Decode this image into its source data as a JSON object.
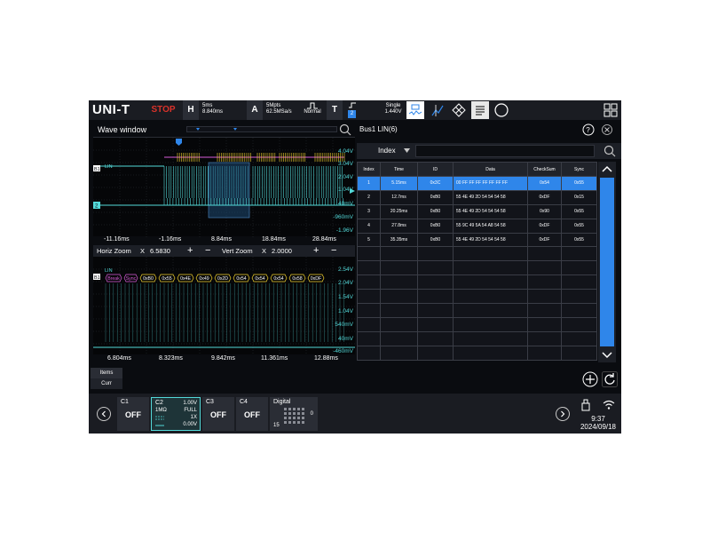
{
  "topbar": {
    "logo": "UNI-T",
    "run_state": "STOP",
    "horizontal": {
      "letter": "H",
      "line1": "5ms",
      "line2": "8.840ms"
    },
    "acquire": {
      "letter": "A",
      "line1": "5Mpts",
      "line2": "62.5MSa/s",
      "mode": "Normal"
    },
    "trigger": {
      "letter": "T",
      "source": "2",
      "mode": "Single",
      "level": "1.440V"
    },
    "colors": {
      "stop": "#d9322a",
      "accent": "#2f86ea",
      "c1": "#f2d22e",
      "c2": "#53d9d9"
    }
  },
  "wave": {
    "title": "Wave window",
    "upper_axis": [
      "-11.16ms",
      "-1.16ms",
      "8.84ms",
      "18.84ms",
      "28.84ms"
    ],
    "upper_volts": [
      "4.04V",
      "3.04V",
      "2.04V",
      "1.04V",
      "40mV",
      "-960mV",
      "-1.96V"
    ],
    "channel_labels": {
      "bus": "B1",
      "lin": "LIN",
      "ch2": "2"
    },
    "zoom": {
      "horiz_label": "Horiz Zoom",
      "horiz_axis": "X",
      "horiz_value": "6.5830",
      "vert_label": "Vert Zoom",
      "vert_axis": "X",
      "vert_value": "2.0000",
      "plus": "+",
      "minus": "−"
    },
    "lower_volts": [
      "2.54V",
      "2.04V",
      "1.54V",
      "1.04V",
      "540mV",
      "40mV",
      "-460mV"
    ],
    "lower_axis": [
      "6.804ms",
      "8.323ms",
      "9.842ms",
      "11.361ms",
      "12.88ms"
    ],
    "decode": [
      "Break",
      "Sync",
      "0xB0",
      "0x55",
      "0x4E",
      "0x49",
      "0x2D",
      "0x54",
      "0x54",
      "0x54",
      "0x58",
      "0xDF"
    ]
  },
  "bus": {
    "title": "Bus1 LIN(6)",
    "index_select": "Index",
    "columns": [
      "Index",
      "Time",
      "ID",
      "Data",
      "CheckSum",
      "Sync"
    ],
    "rows": [
      {
        "index": "1",
        "time": "5.15ms",
        "id": "0x3C",
        "data": "00 FF FF FF FF FF FF FF",
        "checksum": "0x54",
        "sync": "0x55"
      },
      {
        "index": "2",
        "time": "12.7ms",
        "id": "0xB0",
        "data": "55 4E 49 2D 54 54 54 58",
        "checksum": "0xDF",
        "sync": "0x15"
      },
      {
        "index": "3",
        "time": "20.25ms",
        "id": "0xB0",
        "data": "55 4E 49 2D 54 54 54 58",
        "checksum": "0x90",
        "sync": "0x55"
      },
      {
        "index": "4",
        "time": "27.8ms",
        "id": "0xB0",
        "data": "55 9C 49 5A 54 A8 54 58",
        "checksum": "0xDF",
        "sync": "0x55"
      },
      {
        "index": "5",
        "time": "35.35ms",
        "id": "0xB0",
        "data": "55 4E 49 2D 54 54 54 58",
        "checksum": "0xDF",
        "sync": "0x55"
      }
    ]
  },
  "measure": {
    "items": "Items",
    "curr": "Curr"
  },
  "bottom": {
    "c1": {
      "name": "C1",
      "state": "OFF"
    },
    "c2": {
      "name": "C2",
      "volts": "1.00V",
      "impedance": "1MΩ",
      "bw": "FULL",
      "probe": "1X",
      "offset": "0.00V"
    },
    "c3": {
      "name": "C3",
      "state": "OFF"
    },
    "c4": {
      "name": "C4",
      "state": "OFF"
    },
    "digital": {
      "name": "Digital",
      "top": "0",
      "bottom": "15"
    },
    "time": "9:37",
    "date": "2024/09/18"
  }
}
